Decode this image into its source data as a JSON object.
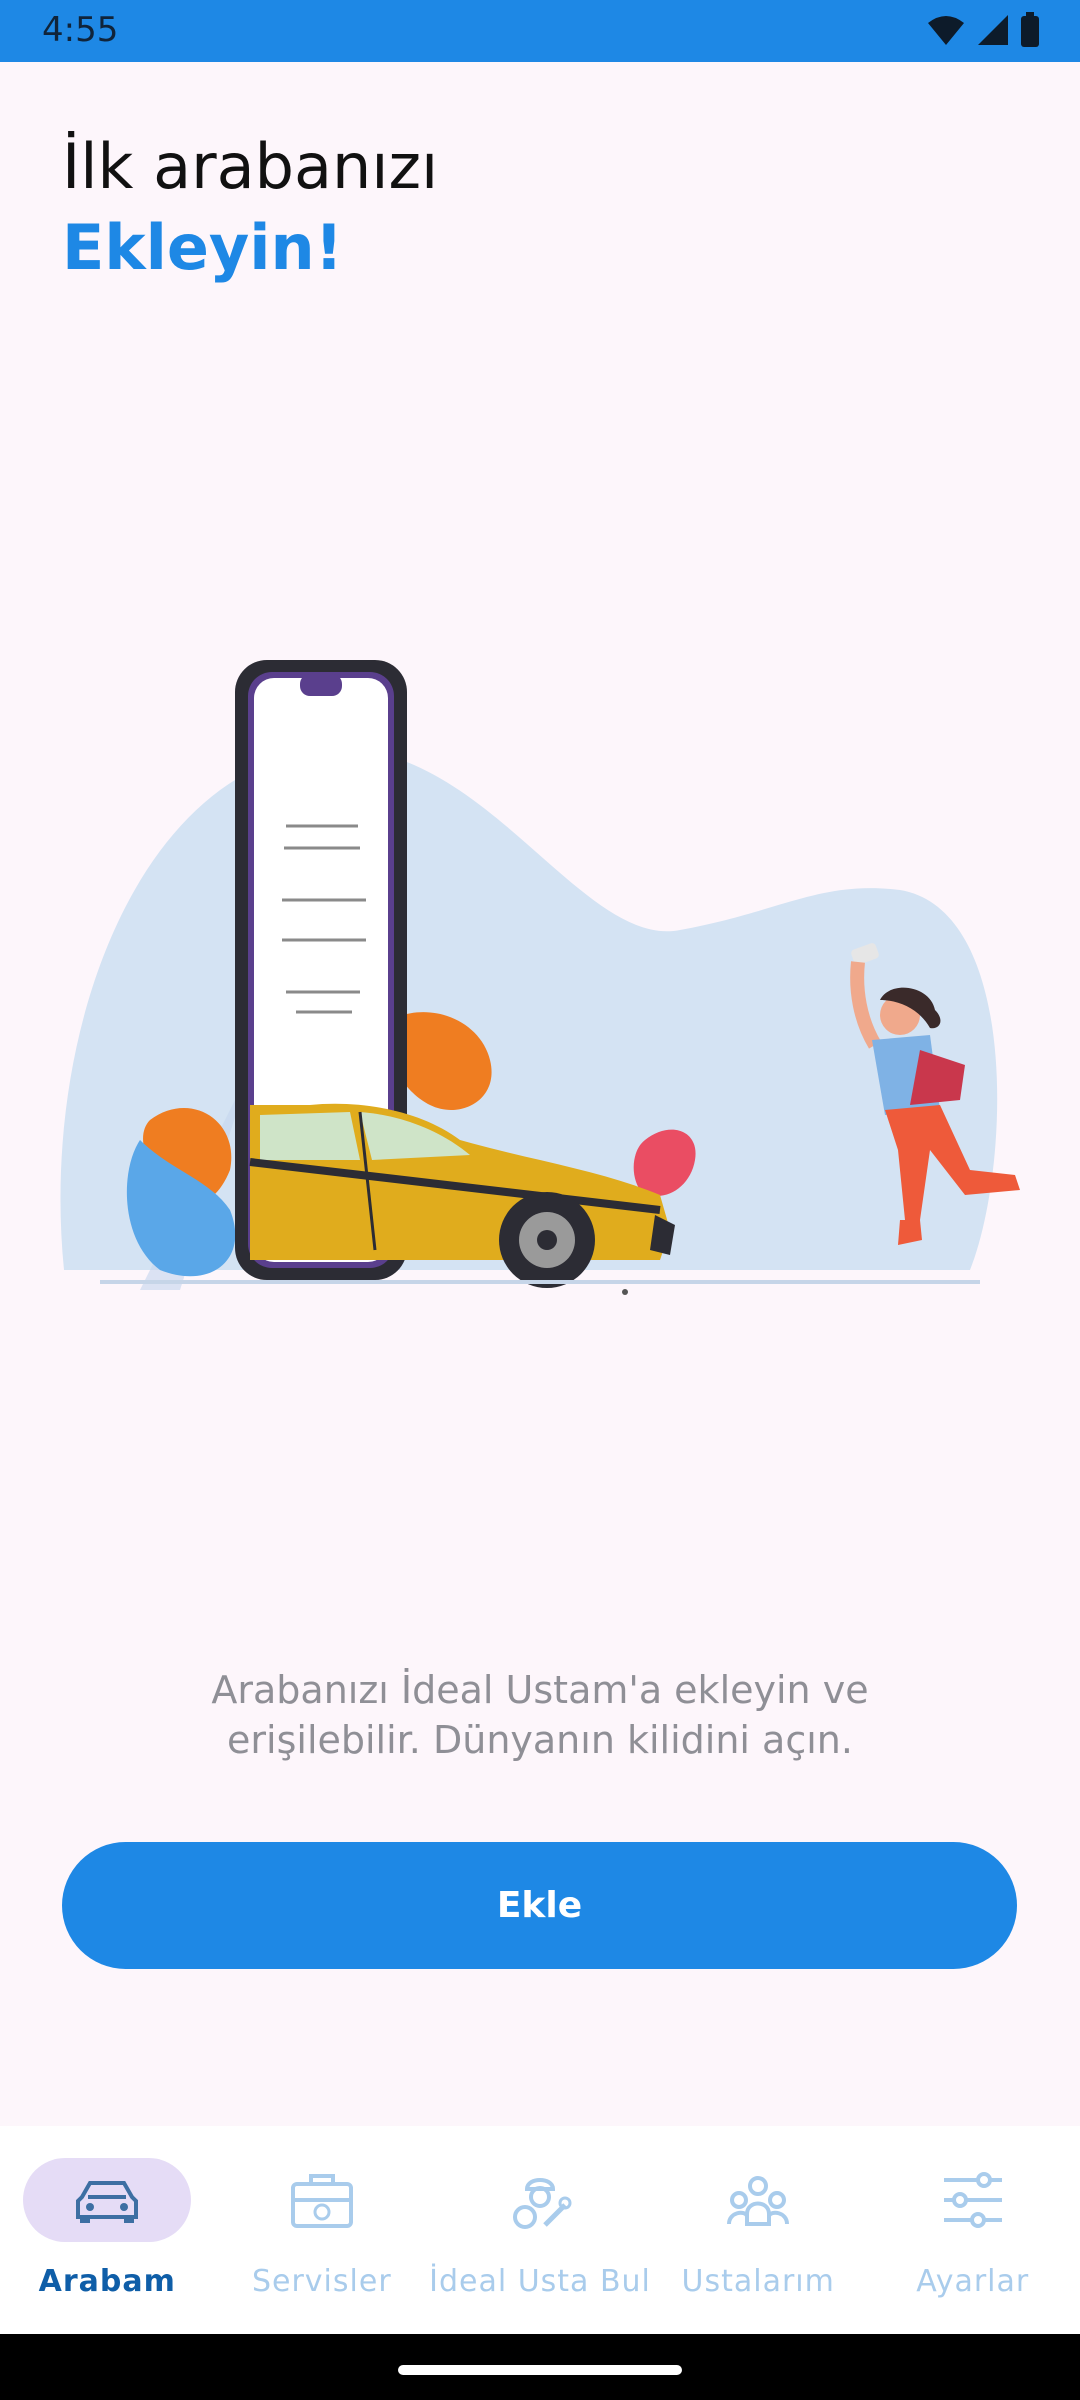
{
  "status_bar": {
    "time": "4:55"
  },
  "heading": {
    "line1": "İlk arabanızı",
    "line2": "Ekleyin!"
  },
  "description": "Arabanızı İdeal Ustam'a ekleyin ve erişilebilir. Dünyanın kilidini açın.",
  "add_button": {
    "label": "Ekle"
  },
  "bottom_nav": {
    "items": [
      {
        "label": "Arabam",
        "icon": "car-icon",
        "active": true
      },
      {
        "label": "Servisler",
        "icon": "toolbox-icon",
        "active": false
      },
      {
        "label": "İdeal Usta Bul",
        "icon": "mechanic-icon",
        "active": false
      },
      {
        "label": "Ustalarım",
        "icon": "team-icon",
        "active": false
      },
      {
        "label": "Ayarlar",
        "icon": "sliders-icon",
        "active": false
      }
    ]
  },
  "colors": {
    "accent": "#1e88e5",
    "background": "#fdf6fb",
    "active_nav": "#0f5ea8",
    "inactive_nav": "#a9ccec",
    "active_pill": "#e5dcf6"
  }
}
